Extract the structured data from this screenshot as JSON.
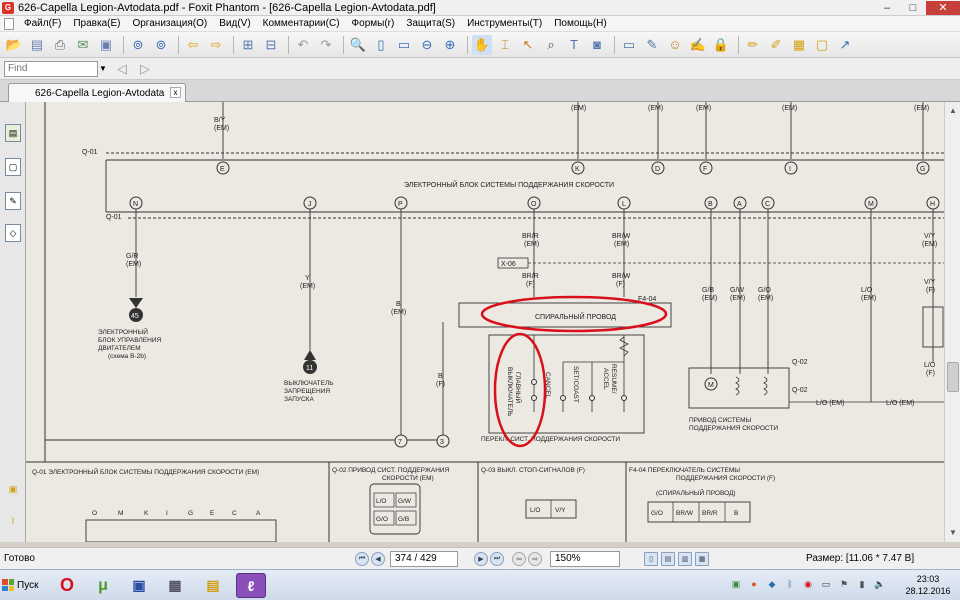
{
  "window": {
    "title": "626-Capella Legion-Avtodata.pdf - Foxit Phantom - [626-Capella Legion-Avtodata.pdf]",
    "minimize": "–",
    "restore": "□",
    "close": "✕"
  },
  "menu": [
    "Файл(F)",
    "Правка(E)",
    "Организация(O)",
    "Вид(V)",
    "Комментарии(C)",
    "Формы(r)",
    "Защита(S)",
    "Инструменты(T)",
    "Помощь(H)"
  ],
  "find": {
    "placeholder": "Find"
  },
  "tab": {
    "label": "626-Capella Legion-Avtodata",
    "close": "x"
  },
  "document": {
    "top_connectors": [
      "(EM)",
      "(EM)",
      "(EM)",
      "(EM)",
      "(EM)"
    ],
    "by_wire": [
      "B/Y",
      "(EM)"
    ],
    "q01": "Q-01",
    "q02": "Q-02",
    "f404": "F4-04",
    "x06": "X-06",
    "ecu_label": "ЭЛЕКТРОННЫЙ БЛОК СИСТЕМЫ ПОДДЕРЖАНИЯ СКОРОСТИ",
    "upper_pins": [
      "E",
      "K",
      "D",
      "F",
      "I",
      "G"
    ],
    "lower_pins": [
      "N",
      "J",
      "P",
      "O",
      "L",
      "B",
      "A",
      "C",
      "M",
      "H"
    ],
    "wire_gr": [
      "G/R",
      "(EM)"
    ],
    "wire_y": [
      "Y",
      "(EM)"
    ],
    "wire_b": [
      "B",
      "(EM)"
    ],
    "wire_bf": [
      "B",
      "(F)"
    ],
    "wire_brr": [
      "BR/R",
      "(EM)"
    ],
    "wire_brw": [
      "BR/W",
      "(EM)"
    ],
    "wire_brr_f": [
      "BR/R",
      "(F)"
    ],
    "wire_brw_f": [
      "BR/W",
      "(F)"
    ],
    "wire_gb": [
      "G/B",
      "(EM)"
    ],
    "wire_gw": [
      "G/W",
      "(EM)"
    ],
    "wire_go": [
      "G/O",
      "(EM)"
    ],
    "wire_lo": [
      "L/O",
      "(EM)"
    ],
    "wire_vy": [
      "V/Y",
      "(EM)"
    ],
    "wire_vy_f": [
      "V/Y",
      "(F)"
    ],
    "wire_lo_f": [
      "L/O",
      "(F)"
    ],
    "lo_em_1": "L/O (EM)",
    "lo_em_2": "L/O (EM)",
    "ref45": "45",
    "ref11": "11",
    "ref7": "7",
    "ref3": "3",
    "engine_ecu": [
      "ЭЛЕКТРОННЫЙ",
      "БЛОК УПРАВЛЕНИЯ",
      "ДВИГАТЕЛЕМ",
      "(схема B-2b)"
    ],
    "start_inhibit": [
      "ВЫКЛЮЧАТЕЛЬ",
      "ЗАПРЕЩЕНИЯ",
      "ЗАПУСКА"
    ],
    "clockspring": "СПИРАЛЬНЫЙ ПРОВОД",
    "main_switch": [
      "ГЛАВНЫЙ",
      "ВЫКЛЮЧАТЕЛЬ"
    ],
    "cancel": "CANCEL",
    "set_coast": "SET/COAST",
    "resume_accel": [
      "RESUME/",
      "ACCEL"
    ],
    "switch_box": "ПЕРЕКЛ. СИСТ. ПОДДЕРЖАНИЯ СКОРОСТИ",
    "actuator": [
      "ПРИВОД СИСТЕМЫ",
      "ПОДДЕРЖАНИЯ СКОРОСТИ"
    ],
    "m": "M",
    "bottom": {
      "q01_desc": "Q-01  ЭЛЕКТРОННЫЙ БЛОК СИСТЕМЫ ПОДДЕРЖАНИЯ СКОРОСТИ (EM)",
      "q02_desc": [
        "Q-02  ПРИВОД СИСТ. ПОДДЕРЖАНИЯ",
        "СКОРОСТИ (EM)"
      ],
      "q03_desc": "Q-03  ВЫКЛ. СТОП-СИГНАЛОВ (F)",
      "f404_desc": [
        "F4-04  ПЕРЕКЛЮЧАТЕЛЬ СИСТЕМЫ",
        "ПОДДЕРЖАНИЯ СКОРОСТИ (F)"
      ],
      "f404_sub": "(СПИРАЛЬНЫЙ ПРОВОД)",
      "q01_pins": [
        "O",
        "M",
        "K",
        "I",
        "G",
        "E",
        "C",
        "A"
      ],
      "q02_pins": [
        "L/O",
        "G/W",
        "G/O",
        "G/B"
      ],
      "q03_pins": [
        "L/O",
        "V/Y"
      ],
      "f404_pins": [
        "G/O",
        "BR/W",
        "BR/R",
        "B"
      ]
    }
  },
  "status": {
    "ready": "Готово",
    "page": "374 / 429",
    "zoom": "150%",
    "size": "Размер: [11.06 * 7.47 В]"
  },
  "taskbar": {
    "start": "Пуск",
    "time": "23:03",
    "date": "28.12.2016"
  }
}
